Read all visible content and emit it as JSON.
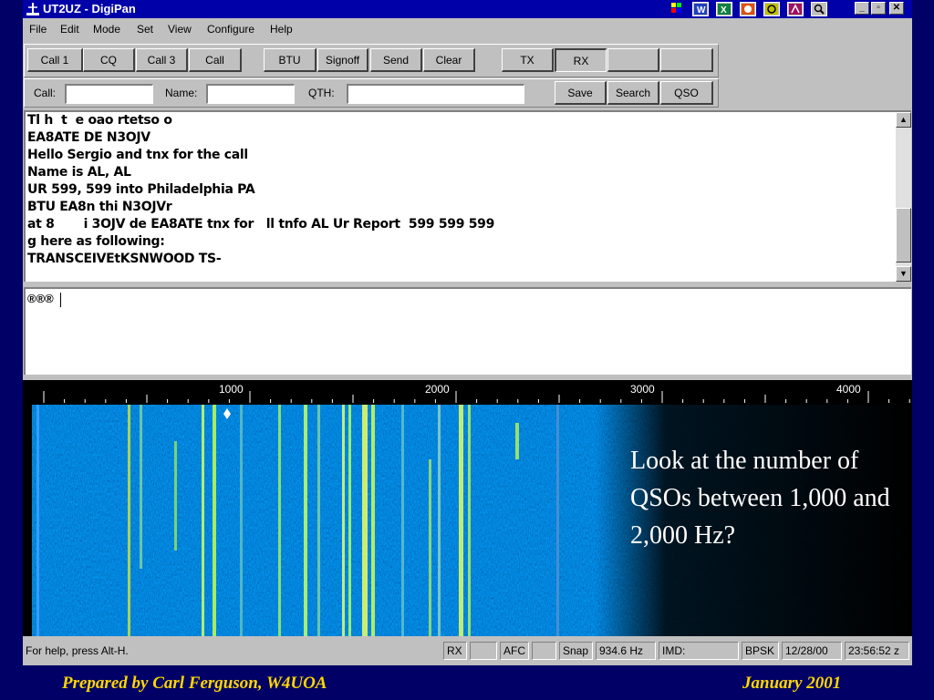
{
  "window": {
    "title": "UT2UZ - DigiPan",
    "controls": {
      "minimize": "_",
      "restore": "▫",
      "close": "✕"
    }
  },
  "menu": [
    {
      "label": "File"
    },
    {
      "label": "Edit"
    },
    {
      "label": "Mode"
    },
    {
      "label": "Set"
    },
    {
      "label": "View"
    },
    {
      "label": "Configure"
    },
    {
      "label": "Help"
    }
  ],
  "toolbar": {
    "buttons": [
      "Call 1",
      "CQ",
      "Call 3",
      "Call",
      "BTU",
      "Signoff",
      "Send",
      "Clear",
      "TX",
      "RX",
      "",
      ""
    ]
  },
  "fields": {
    "call_label": "Call:",
    "call_value": "",
    "name_label": "Name:",
    "name_value": "",
    "qth_label": "QTH:",
    "qth_value": "",
    "save": "Save",
    "search": "Search",
    "qso": "QSO"
  },
  "rx_text": [
    "Tl h  t  e oao rtetso o",
    "EA8ATE DE N3OJV",
    "Hello Sergio and tnx for the call",
    "Name is AL, AL",
    "UR 599, 599 into Philadelphia PA",
    "BTU EA8n thi N3OJVr",
    "at 8       i 3OJV de EA8ATE tnx for   ll tnfo AL Ur Report  599 599 599",
    "g here as following:",
    "TRANSCEIVEtKSNWOOD TS-"
  ],
  "tx_text": "®®®",
  "waterfall": {
    "freq_labels": [
      "1000",
      "2000",
      "3000",
      "4000"
    ],
    "callout": "Look at the number of QSOs between 1,000 and 2,000 Hz?"
  },
  "status": {
    "help": "For help, press Alt-H.",
    "rx": "RX",
    "blank1": "",
    "afc": "AFC",
    "blank2": "",
    "snap": "Snap",
    "freq": "934.6 Hz",
    "imd": "IMD:",
    "mode": "BPSK",
    "date": "12/28/00",
    "time": "23:56:52 z"
  },
  "footer": {
    "left": "Prepared by Carl Ferguson, W4UOA",
    "right": "January 2001"
  },
  "colors": {
    "slide_bg": "#000066",
    "titlebar": "#0000a8",
    "footer_text": "#ffd700",
    "waterfall_bg": "#0a1a6e"
  }
}
